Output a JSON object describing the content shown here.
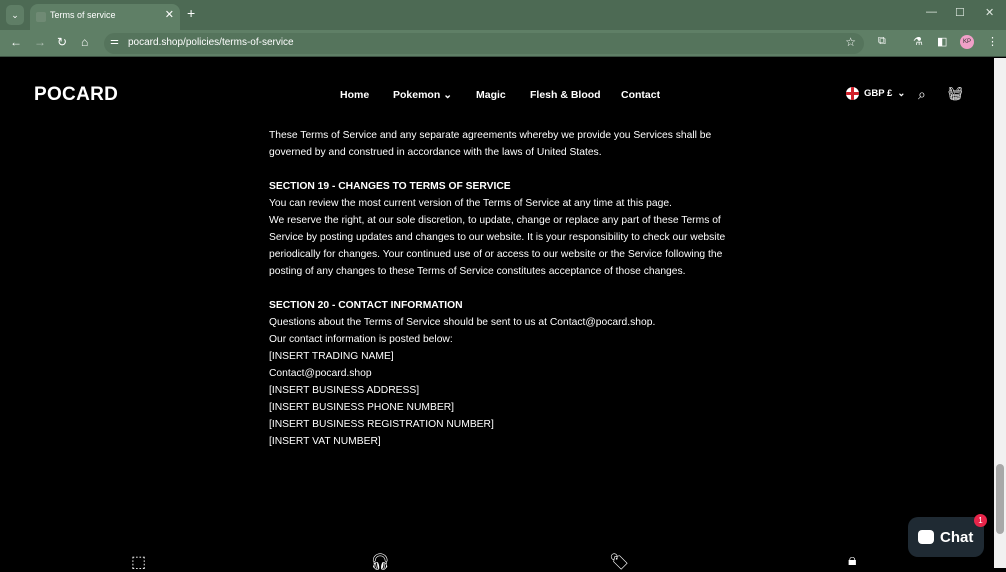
{
  "browser": {
    "tab_title": "Terms of service",
    "url": "pocard.shop/policies/terms-of-service",
    "profile_initials": "KP"
  },
  "site": {
    "logo": "POCARD",
    "nav": [
      {
        "label": "Home"
      },
      {
        "label": "Pokemon",
        "has_dropdown": true
      },
      {
        "label": "Magic"
      },
      {
        "label": "Flesh & Blood"
      },
      {
        "label": "Contact"
      }
    ],
    "currency": "GBP £"
  },
  "content": {
    "p1": [
      "These Terms of Service and any separate agreements whereby we provide you Services shall be",
      "governed by and construed in accordance with the laws of United States."
    ],
    "s19_heading": "SECTION 19 - CHANGES TO TERMS OF SERVICE",
    "s19": [
      "You can review the most current version of the Terms of Service at any time at this page.",
      "We reserve the right, at our sole discretion, to update, change or replace any part of these Terms of",
      "Service by posting updates and changes to our website. It is your responsibility to check our website",
      "periodically for changes. Your continued use of or access to our website or the Service following the",
      "posting of any changes to these Terms of Service constitutes acceptance of those changes."
    ],
    "s20_heading": "SECTION 20 - CONTACT INFORMATION",
    "s20": [
      "Questions about the Terms of Service should be sent to us at Contact@pocard.shop.",
      "Our contact information is posted below:",
      "[INSERT TRADING NAME]",
      "Contact@pocard.shop",
      "[INSERT BUSINESS ADDRESS]",
      "[INSERT BUSINESS PHONE NUMBER]",
      "[INSERT BUSINESS REGISTRATION NUMBER]",
      "[INSERT VAT NUMBER]"
    ]
  },
  "chat": {
    "label": "Chat",
    "badge": "1"
  },
  "colors": {
    "chrome": "#5f7f66",
    "page_bg": "#000000",
    "chat_bg": "#1f2a33",
    "badge": "#e8254a"
  }
}
